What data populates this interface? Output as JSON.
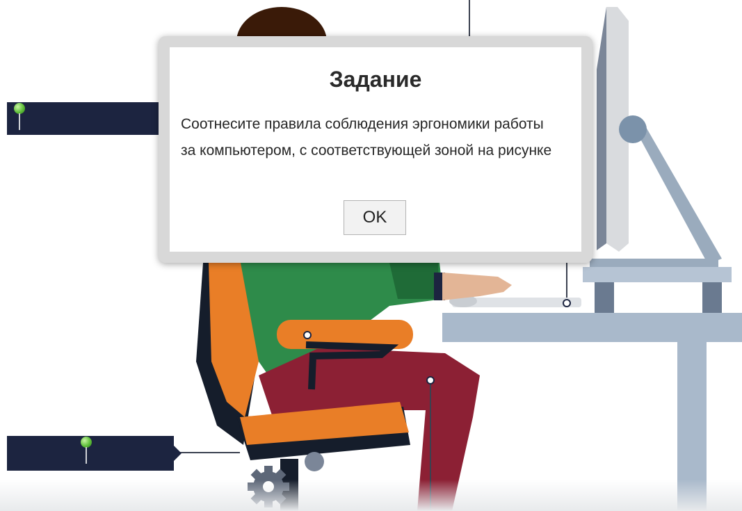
{
  "dialog": {
    "title": "Задание",
    "message": "Соотнесите правила соблюдения эргономики работы за компьютером, с соответствующей зоной на рисунке",
    "ok_label": "OK"
  },
  "zone_labels": [
    {
      "text": ""
    },
    {
      "text": ""
    }
  ],
  "colors": {
    "label_bg": "#1c2440",
    "desk": "#a9b9cb",
    "chair_orange": "#e97e27",
    "chair_frame": "#151d2b",
    "shirt": "#2e8b4a",
    "pants": "#8c2034",
    "hair": "#3a1a08",
    "pin": "#5fbf3a"
  }
}
